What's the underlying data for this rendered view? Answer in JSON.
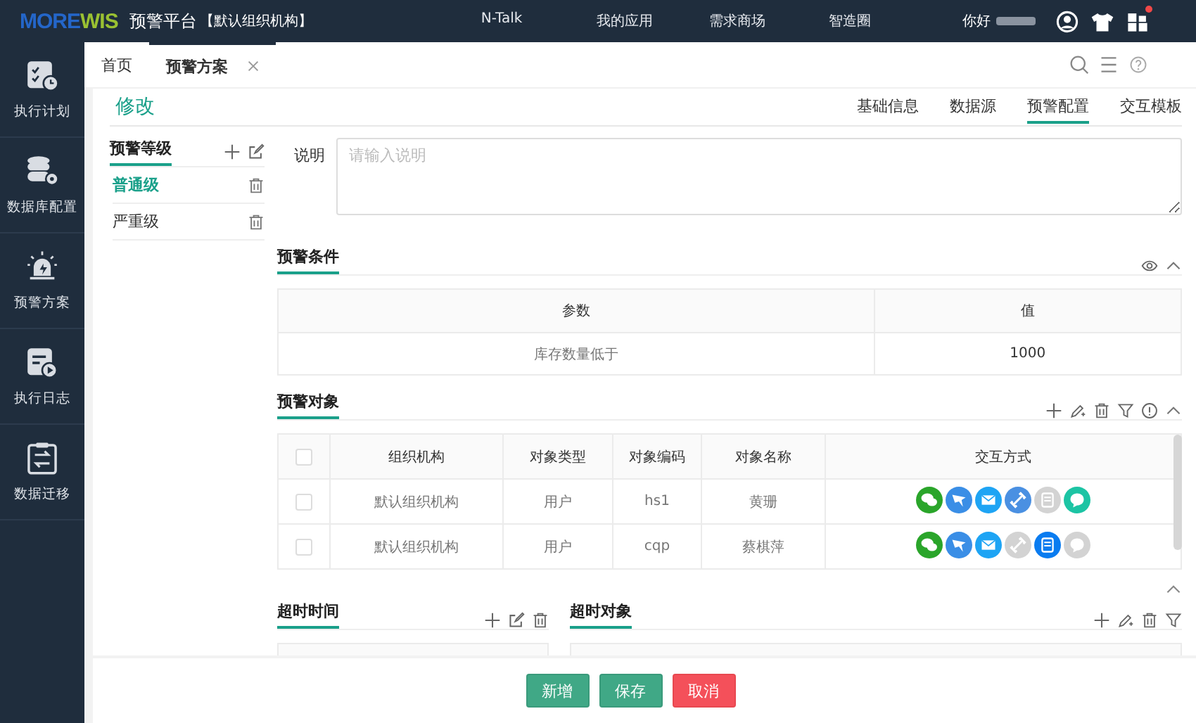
{
  "topbar": {
    "logo_a": "MORE",
    "logo_b": "WIS",
    "title": "预警平台",
    "org": "【默认组织机构】",
    "nav": [
      "N-Talk",
      "我的应用",
      "需求商场",
      "智造圈"
    ],
    "greeting": "你好",
    "notification": true
  },
  "sidebar": [
    "执行计划",
    "数据库配置",
    "预警方案",
    "执行日志",
    "数据迁移"
  ],
  "tabs": [
    {
      "label": "首页",
      "selected": false,
      "closable": false
    },
    {
      "label": "预警方案",
      "selected": true,
      "closable": true
    }
  ],
  "page": {
    "title": "修改",
    "subtabs": [
      {
        "label": "基础信息",
        "selected": false
      },
      {
        "label": "数据源",
        "selected": false
      },
      {
        "label": "预警配置",
        "selected": true
      },
      {
        "label": "交互模板",
        "selected": false
      }
    ]
  },
  "levels": {
    "title": "预警等级",
    "items": [
      {
        "label": "普通级",
        "selected": true
      },
      {
        "label": "严重级",
        "selected": false
      }
    ]
  },
  "description": {
    "label": "说明",
    "placeholder": "请输入说明"
  },
  "condition": {
    "title": "预警条件",
    "columns": [
      "参数",
      "值"
    ],
    "rows": [
      [
        "库存数量低于",
        "1000"
      ]
    ]
  },
  "objects": {
    "title": "预警对象",
    "all_checked": false,
    "columns": [
      "组织机构",
      "对象类型",
      "对象编码",
      "对象名称",
      "交互方式"
    ],
    "rows": [
      {
        "checked": false,
        "cells": [
          "默认组织机构",
          "用户",
          "hs1",
          "黄珊"
        ],
        "channels": [
          {
            "kind": "wechat",
            "on": true
          },
          {
            "kind": "dingtalk",
            "on": true
          },
          {
            "kind": "email",
            "on": true
          },
          {
            "kind": "link",
            "on": true
          },
          {
            "kind": "sms",
            "on": false
          },
          {
            "kind": "chat",
            "on": true
          }
        ]
      },
      {
        "checked": false,
        "cells": [
          "默认组织机构",
          "用户",
          "cqp",
          "蔡棋萍"
        ],
        "channels": [
          {
            "kind": "wechat",
            "on": true
          },
          {
            "kind": "dingtalk",
            "on": true
          },
          {
            "kind": "email",
            "on": true
          },
          {
            "kind": "link",
            "on": false
          },
          {
            "kind": "sms",
            "on": true
          },
          {
            "kind": "chat",
            "on": false
          }
        ]
      }
    ]
  },
  "timeout_time": {
    "title": "超时时间"
  },
  "timeout_objects": {
    "title": "超时对象"
  },
  "buttons": [
    {
      "label": "新增",
      "kind": "primary"
    },
    {
      "label": "保存",
      "kind": "primary"
    },
    {
      "label": "取消",
      "kind": "danger"
    }
  ]
}
